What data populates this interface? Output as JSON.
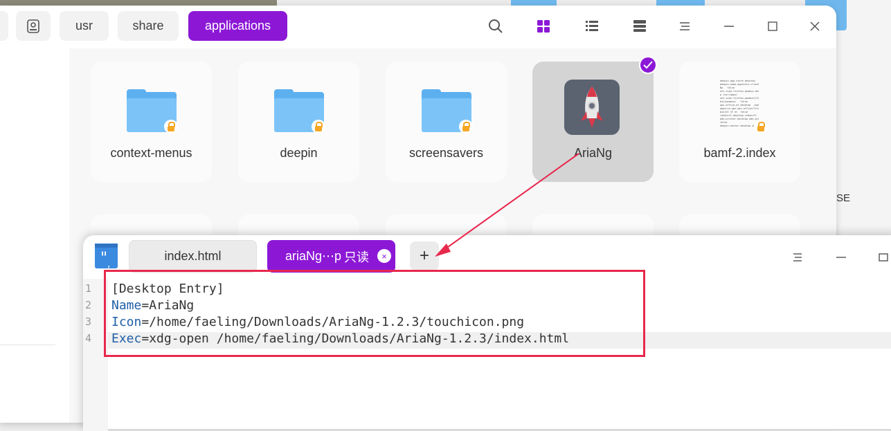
{
  "file_manager": {
    "breadcrumbs": [
      {
        "label": "",
        "icon": "disk-icon"
      },
      {
        "label": "usr"
      },
      {
        "label": "share"
      },
      {
        "label": "applications",
        "active": true
      }
    ],
    "toolbar_icons": [
      "search-icon",
      "grid-view-icon",
      "list-view-icon",
      "tree-view-icon",
      "menu-icon",
      "minimize-icon",
      "maximize-icon",
      "close-icon"
    ],
    "items": [
      {
        "name": "context-menus",
        "type": "folder",
        "locked": true
      },
      {
        "name": "deepin",
        "type": "folder",
        "locked": true
      },
      {
        "name": "screensavers",
        "type": "folder",
        "locked": true
      },
      {
        "name": "AriaNg",
        "type": "app",
        "selected": true
      },
      {
        "name": "bamf-2.index",
        "type": "document",
        "locked": true,
        "thumbnail_text": "deepin-app-store.desktop\ndeepin-home-appstore-client\nNo   false\nnet.xiph.firefox.peamco.deskto\np /usr/apps/\nnet.xiph.firefox.peamcof/files/\nbin/peamcor   false\nwps-office-et.desktop  /opt/\napps/cn.wps.wps-office/files/\nbin/et %F et  false\nredshift.desktop redshift  true\ndde-printer.desktop dde-pri\nfalse\ndeepin-editor.desktop deepin"
      }
    ]
  },
  "editor": {
    "tabs": [
      {
        "label": "index.html",
        "active": false
      },
      {
        "label": "ariaNg⋯p",
        "readonly_badge": "只读",
        "active": true
      }
    ],
    "add_tab_label": "+",
    "lines": [
      {
        "number": "1",
        "key": "",
        "text": "[Desktop Entry]"
      },
      {
        "number": "2",
        "key": "Name",
        "text": "=AriaNg"
      },
      {
        "number": "3",
        "key": "Icon",
        "text": "=/home/faeling/Downloads/AriaNg-1.2.3/touchicon.png"
      },
      {
        "number": "4",
        "key": "Exec",
        "text": "=xdg-open /home/faeling/Downloads/AriaNg-1.2.3/index.html"
      }
    ],
    "current_line": "4"
  },
  "background": {
    "right_text": "SE"
  },
  "colors": {
    "accent": "#8c18d6",
    "annotation": "#e8284d",
    "folder": "#7cc4f8",
    "lock": "#f5a623"
  }
}
